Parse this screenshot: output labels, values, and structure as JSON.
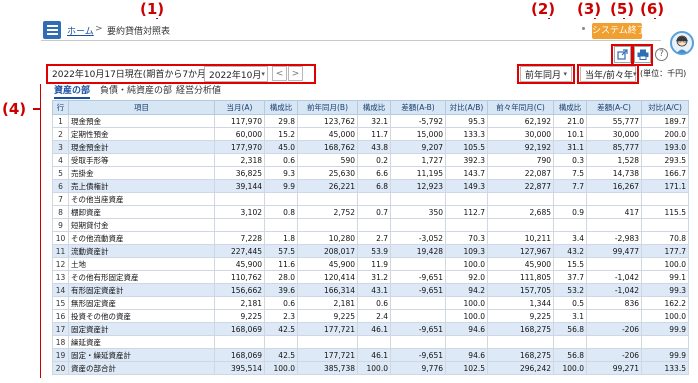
{
  "callouts": [
    "(1)",
    "(2)",
    "(3)",
    "(4)",
    "(5)",
    "(6)"
  ],
  "header": {
    "home_link": "ホーム",
    "separator": ">",
    "page_title": "要約貸借対照表",
    "system_button": "システム終了"
  },
  "filters": {
    "date_text": "2022年10月17日現在(期首から7か月)",
    "month_select": "2022年10月",
    "prev_arrow": "<",
    "next_arrow": ">",
    "compare_select": "前年同月",
    "period_select": "当年/前々年",
    "unit_label": "(単位：千円)"
  },
  "tabs": [
    "資産の部",
    "負債・純資産の部",
    "経営分析値"
  ],
  "table": {
    "headers": [
      "行",
      "項目",
      "当月(A)",
      "構成比",
      "前年同月(B)",
      "構成比",
      "差額(A-B)",
      "対比(A/B)",
      "前々年同月(C)",
      "構成比",
      "差額(A-C)",
      "対比(A/C)"
    ],
    "rows": [
      [
        "1",
        "現金預金",
        "117,970",
        "29.8",
        "123,762",
        "32.1",
        "-5,792",
        "95.3",
        "62,192",
        "21.0",
        "55,777",
        "189.7"
      ],
      [
        "2",
        "定期性預金",
        "60,000",
        "15.2",
        "45,000",
        "11.7",
        "15,000",
        "133.3",
        "30,000",
        "10.1",
        "30,000",
        "200.0"
      ],
      [
        "3",
        "現金預金計",
        "177,970",
        "45.0",
        "168,762",
        "43.8",
        "9,207",
        "105.5",
        "92,192",
        "31.1",
        "85,777",
        "193.0"
      ],
      [
        "4",
        "受取手形等",
        "2,318",
        "0.6",
        "590",
        "0.2",
        "1,727",
        "392.3",
        "790",
        "0.3",
        "1,528",
        "293.5"
      ],
      [
        "5",
        "売掛金",
        "36,825",
        "9.3",
        "25,630",
        "6.6",
        "11,195",
        "143.7",
        "22,087",
        "7.5",
        "14,738",
        "166.7"
      ],
      [
        "6",
        "売上債権計",
        "39,144",
        "9.9",
        "26,221",
        "6.8",
        "12,923",
        "149.3",
        "22,877",
        "7.7",
        "16,267",
        "171.1"
      ],
      [
        "7",
        "その他当座資産",
        "",
        "",
        "",
        "",
        "",
        "",
        "",
        "",
        "",
        ""
      ],
      [
        "8",
        "棚卸資産",
        "3,102",
        "0.8",
        "2,752",
        "0.7",
        "350",
        "112.7",
        "2,685",
        "0.9",
        "417",
        "115.5"
      ],
      [
        "9",
        "短期貸付金",
        "",
        "",
        "",
        "",
        "",
        "",
        "",
        "",
        "",
        ""
      ],
      [
        "10",
        "その他流動資産",
        "7,228",
        "1.8",
        "10,280",
        "2.7",
        "-3,052",
        "70.3",
        "10,211",
        "3.4",
        "-2,983",
        "70.8"
      ],
      [
        "11",
        "流動資産計",
        "227,445",
        "57.5",
        "208,017",
        "53.9",
        "19,428",
        "109.3",
        "127,967",
        "43.2",
        "99,477",
        "177.7"
      ],
      [
        "12",
        "土地",
        "45,900",
        "11.6",
        "45,900",
        "11.9",
        "",
        "100.0",
        "45,900",
        "15.5",
        "",
        "100.0"
      ],
      [
        "13",
        "その他有形固定資産",
        "110,762",
        "28.0",
        "120,414",
        "31.2",
        "-9,651",
        "92.0",
        "111,805",
        "37.7",
        "-1,042",
        "99.1"
      ],
      [
        "14",
        "有形固定資産計",
        "156,662",
        "39.6",
        "166,314",
        "43.1",
        "-9,651",
        "94.2",
        "157,705",
        "53.2",
        "-1,042",
        "99.3"
      ],
      [
        "15",
        "無形固定資産",
        "2,181",
        "0.6",
        "2,181",
        "0.6",
        "",
        "100.0",
        "1,344",
        "0.5",
        "836",
        "162.2"
      ],
      [
        "16",
        "投資その他の資産",
        "9,225",
        "2.3",
        "9,225",
        "2.4",
        "",
        "100.0",
        "9,225",
        "3.1",
        "",
        "100.0"
      ],
      [
        "17",
        "固定資産計",
        "168,069",
        "42.5",
        "177,721",
        "46.1",
        "-9,651",
        "94.6",
        "168,275",
        "56.8",
        "-206",
        "99.9"
      ],
      [
        "18",
        "繰延資産",
        "",
        "",
        "",
        "",
        "",
        "",
        "",
        "",
        "",
        ""
      ],
      [
        "19",
        "固定・繰延資産計",
        "168,069",
        "42.5",
        "177,721",
        "46.1",
        "-9,651",
        "94.6",
        "168,275",
        "56.8",
        "-206",
        "99.9"
      ],
      [
        "20",
        "資産の部合計",
        "395,514",
        "100.0",
        "385,738",
        "100.0",
        "9,776",
        "102.5",
        "296,242",
        "100.0",
        "99,271",
        "133.5"
      ]
    ],
    "subtotal_rows": [
      "3",
      "6",
      "11",
      "14",
      "17",
      "19",
      "20"
    ]
  },
  "icons": {
    "menu": "hamburger-menu-icon",
    "export": "export-icon",
    "print": "printer-icon",
    "help": "help-icon",
    "avatar": "user-avatar-icon"
  },
  "colors": {
    "annotation_red": "#e00000",
    "header_blue": "#d6e6f4",
    "subtotal_blue": "#dde9f6",
    "system_button": "#f0a030",
    "menu_blue": "#2f6db5"
  }
}
